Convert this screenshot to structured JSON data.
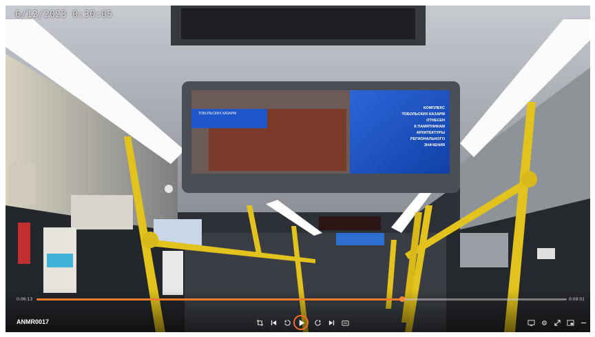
{
  "overlay": {
    "timestamp": "6/12/2023 0:30:05"
  },
  "screen": {
    "header": "ТОБОЛЬСКИХ КАЗАРМ",
    "lines": [
      "КОМПЛЕКС",
      "ТОБОЛЬСКИХ КАЗАРМ",
      "ОТНЕСЕН",
      "К ПАМЯТНИКАМ",
      "АРХИТЕКТУРЫ",
      "РЕГИОНАЛЬНОГО",
      "ЗНАЧЕНИЯ"
    ]
  },
  "player": {
    "title": "ANMR0017",
    "current_time": "0:06:13",
    "duration": "0:09:01",
    "progress": 0.69,
    "accent": "#ee7a2e"
  },
  "icons": [
    "crop-icon",
    "skip-back-icon",
    "rewind-icon",
    "play-icon",
    "forward-icon",
    "skip-forward-icon",
    "caption-icon",
    "display-icon",
    "settings-icon",
    "fullscreen-icon",
    "pip-icon",
    "more-icon"
  ]
}
